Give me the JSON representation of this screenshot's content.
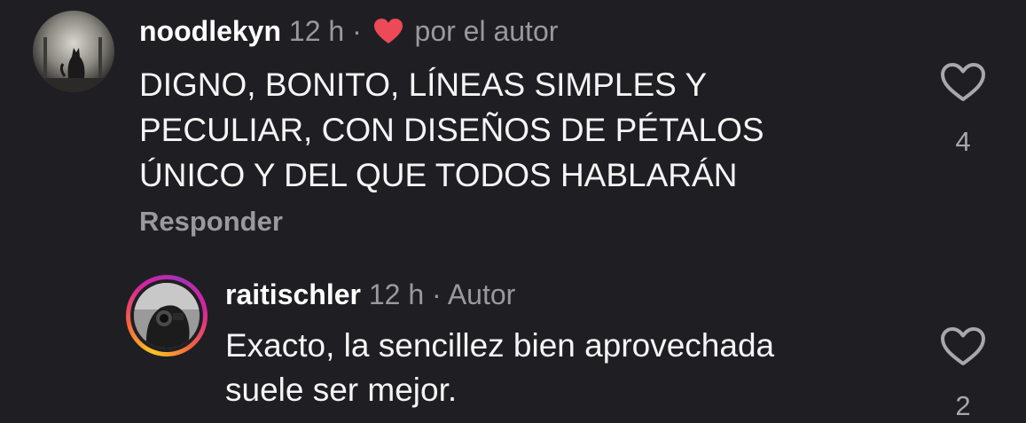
{
  "comment": {
    "username": "noodlekyn",
    "time": "12 h",
    "separator": "·",
    "liked_by": "por el autor",
    "lines": [
      "DIGNO, BONITO, LÍNEAS SIMPLES Y",
      "PECULIAR, CON DISEÑOS DE PÉTALOS",
      "ÚNICO Y DEL QUE TODOS HABLARÁN"
    ],
    "reply_label": "Responder",
    "like_count": "4"
  },
  "reply": {
    "username": "raitischler",
    "time": "12 h",
    "separator": "·",
    "badge": "Autor",
    "lines": [
      "Exacto, la sencillez bien aprovechada",
      "suele ser mejor."
    ],
    "like_count": "2"
  },
  "colors": {
    "background": "#1f1f23",
    "author_heart": "#ed4956",
    "meta_text": "#9a9a9e"
  },
  "icons": {
    "author_heart": "heart-filled-icon",
    "like": "heart-outline-icon"
  }
}
